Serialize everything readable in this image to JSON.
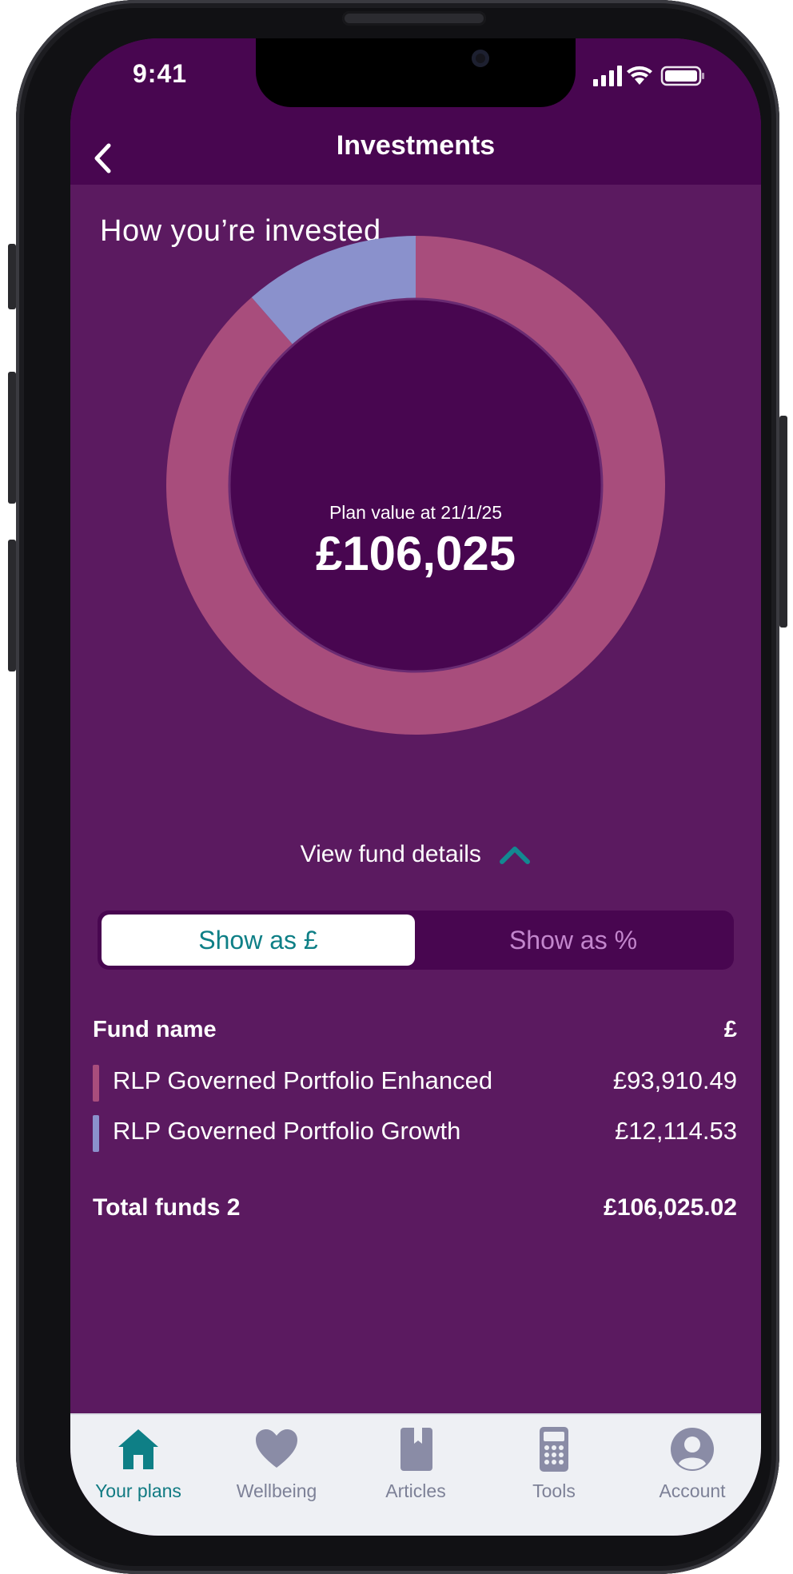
{
  "status_bar": {
    "time": "9:41"
  },
  "header": {
    "title": "Investments"
  },
  "section": {
    "title": "How you’re invested"
  },
  "plan": {
    "value_label": "Plan value at 21/1/25",
    "value": "£106,025"
  },
  "chart_data": {
    "type": "pie",
    "variant": "donut",
    "series": [
      {
        "name": "RLP Governed Portfolio Enhanced",
        "value": 93910.49,
        "color": "#a84d7c"
      },
      {
        "name": "RLP Governed Portfolio Growth",
        "value": 12114.53,
        "color": "#8a91cc"
      }
    ],
    "title": "",
    "center_label": "Plan value at 21/1/25",
    "center_value": "£106,025"
  },
  "view_details": {
    "label": "View fund details"
  },
  "toggle": {
    "pounds_label": "Show as £",
    "percent_label": "Show as %",
    "selected": "pounds"
  },
  "table": {
    "col_fund": "Fund name",
    "col_unit": "£",
    "rows": [
      {
        "name": "RLP Governed Portfolio Enhanced",
        "value": "£93,910.49",
        "color": "#a84d7c"
      },
      {
        "name": "RLP Governed Portfolio Growth",
        "value": "£12,114.53",
        "color": "#8a91cc"
      }
    ],
    "total_label": "Total funds 2",
    "total_value": "£106,025.02"
  },
  "tabbar": {
    "items": [
      {
        "label": "Your plans",
        "icon": "home-icon",
        "active": true
      },
      {
        "label": "Wellbeing",
        "icon": "heart-icon",
        "active": false
      },
      {
        "label": "Articles",
        "icon": "book-icon",
        "active": false
      },
      {
        "label": "Tools",
        "icon": "calculator-icon",
        "active": false
      },
      {
        "label": "Account",
        "icon": "account-icon",
        "active": false
      }
    ]
  },
  "colors": {
    "header_bg": "#480650",
    "screen_bg": "#5b1a60",
    "accent_teal": "#0e7f86",
    "tab_inactive": "#7d8197"
  }
}
